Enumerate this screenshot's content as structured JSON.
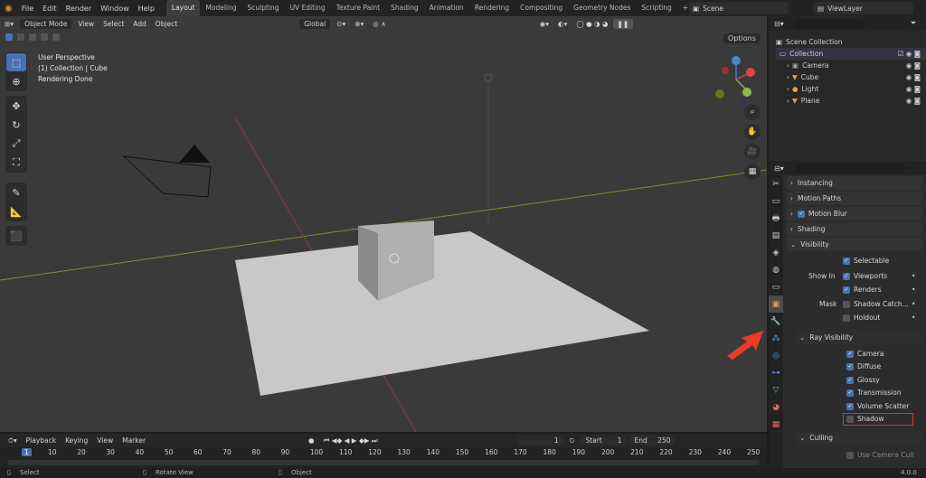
{
  "top_menu": {
    "file": "File",
    "edit": "Edit",
    "render": "Render",
    "window": "Window",
    "help": "Help"
  },
  "workspace_tabs": [
    "Layout",
    "Modeling",
    "Sculpting",
    "UV Editing",
    "Texture Paint",
    "Shading",
    "Animation",
    "Rendering",
    "Compositing",
    "Geometry Nodes",
    "Scripting"
  ],
  "scene": {
    "name": "Scene",
    "view_layer": "ViewLayer"
  },
  "viewport": {
    "mode": "Object Mode",
    "menus": {
      "view": "View",
      "select": "Select",
      "add": "Add",
      "object": "Object"
    },
    "transform_orientation": "Global",
    "options": "Options",
    "info_line1": "User Perspective",
    "info_line2": "(1) Collection | Cube",
    "info_line3": "Rendering Done",
    "gizmo": {
      "x": "X",
      "y": "Y",
      "z": "Z"
    }
  },
  "outliner": {
    "scene_collection": "Scene Collection",
    "collection": "Collection",
    "items": [
      "Camera",
      "Cube",
      "Light",
      "Plane"
    ]
  },
  "properties": {
    "sections": {
      "instancing": "Instancing",
      "motion_paths": "Motion Paths",
      "motion_blur": "Motion Blur",
      "shading": "Shading",
      "visibility": "Visibility",
      "ray_visibility": "Ray Visibility",
      "culling": "Culling"
    },
    "selectable": "Selectable",
    "show_in": "Show In",
    "viewports": "Viewports",
    "renders": "Renders",
    "mask": "Mask",
    "shadow_catcher": "Shadow Catch...",
    "holdout": "Holdout",
    "ray": {
      "camera": "Camera",
      "diffuse": "Diffuse",
      "glossy": "Glossy",
      "transmission": "Transmission",
      "volume_scatter": "Volume Scatter",
      "shadow": "Shadow"
    },
    "use_camera_cull": "Use Camera Cull"
  },
  "timeline": {
    "playback": "Playback",
    "keying": "Keying",
    "view": "View",
    "marker": "Marker",
    "current_frame": "1",
    "start_label": "Start",
    "start": "1",
    "end_label": "End",
    "end": "250",
    "ticks": [
      "1",
      "10",
      "20",
      "30",
      "40",
      "50",
      "60",
      "70",
      "80",
      "90",
      "100",
      "110",
      "120",
      "130",
      "140",
      "150",
      "160",
      "170",
      "180",
      "190",
      "200",
      "210",
      "220",
      "230",
      "240",
      "250"
    ]
  },
  "status": {
    "select": "Select",
    "rotate_view": "Rotate View",
    "object": "Object",
    "version": "4.0.0"
  },
  "colors": {
    "accent": "#4772b3",
    "highlight_box": "#e03030",
    "arrow": "#ee3a2a"
  }
}
